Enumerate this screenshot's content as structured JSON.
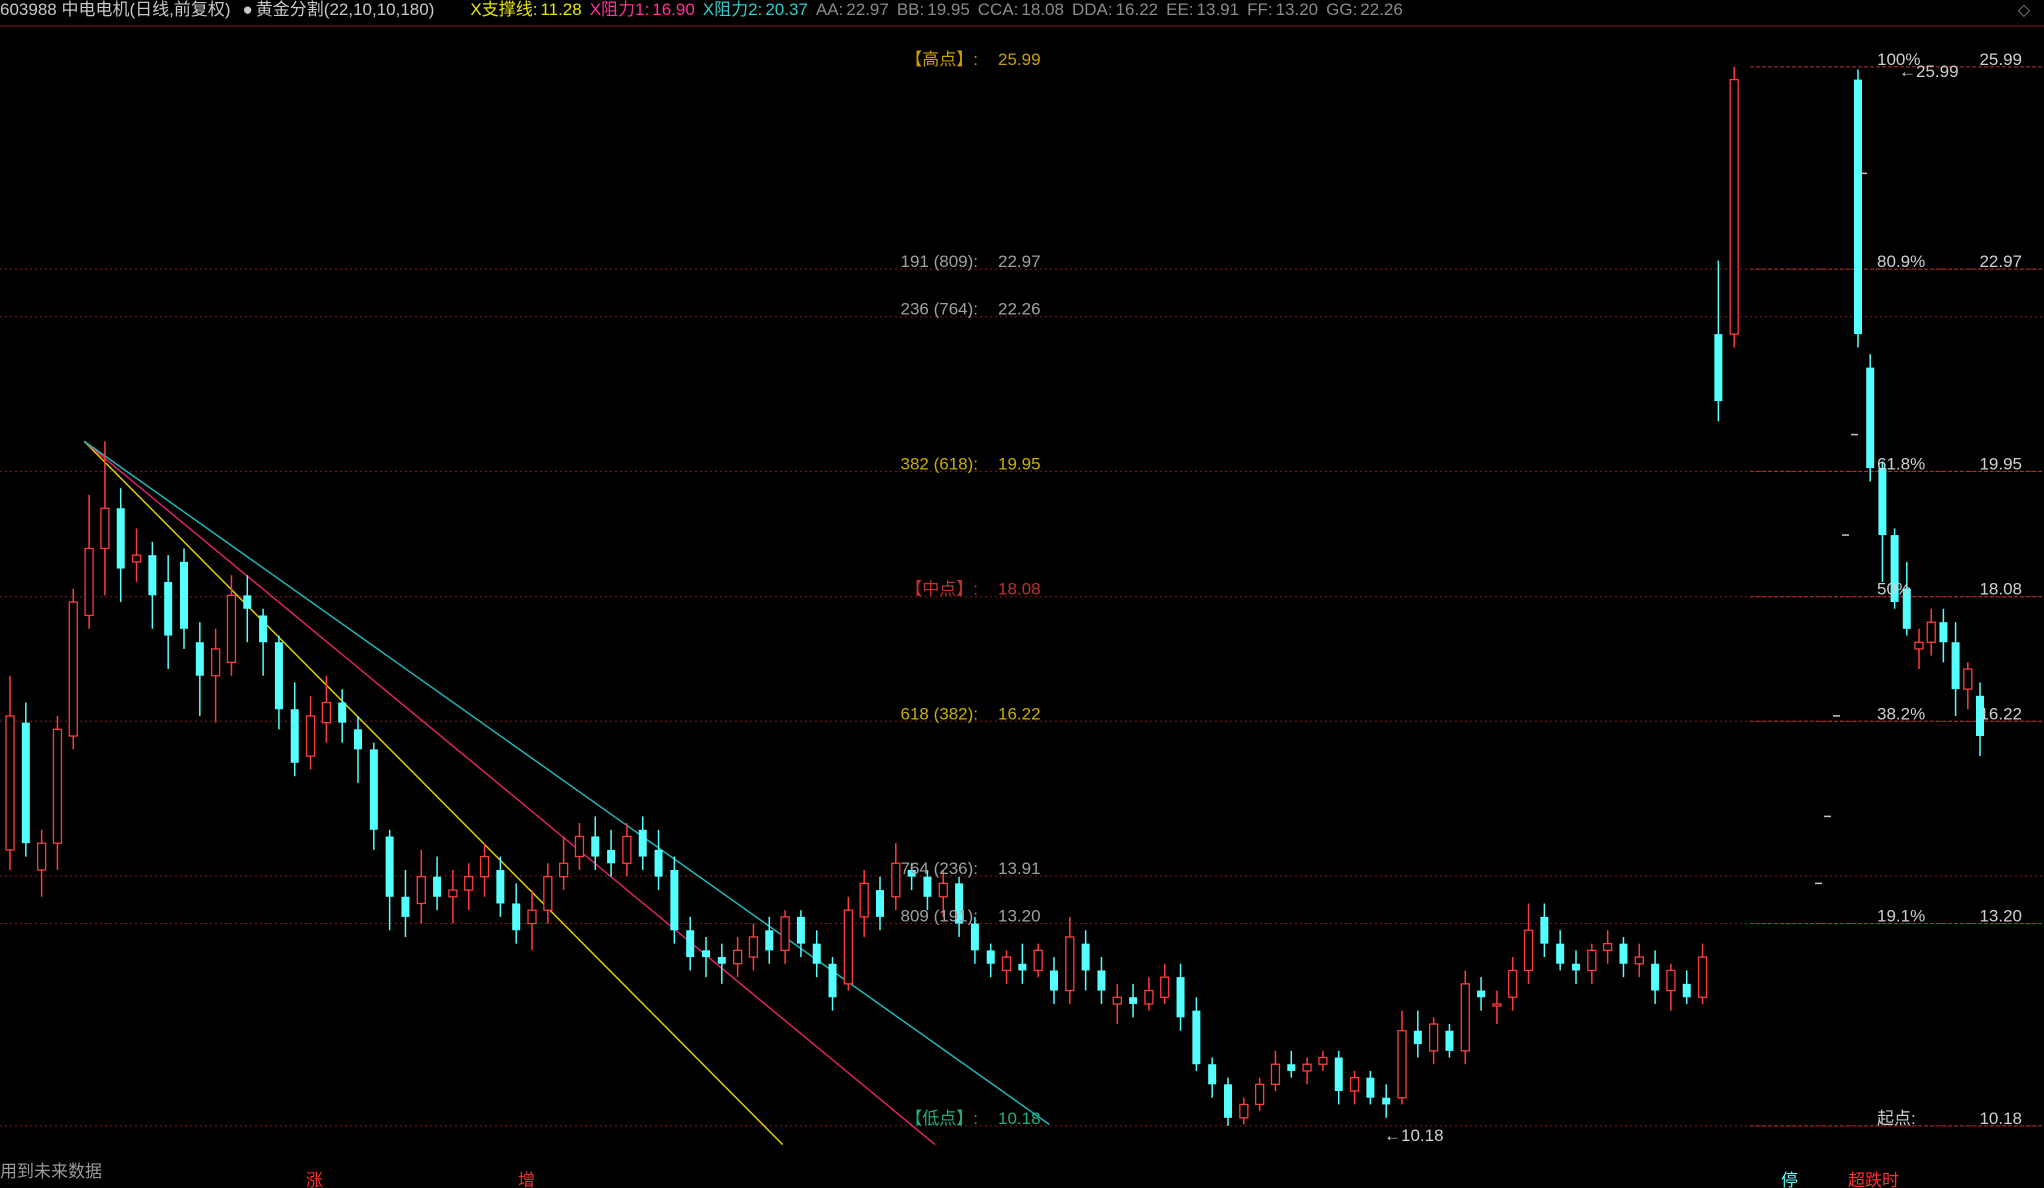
{
  "header": {
    "stock_title": "603988 中电电机(日线,前复权)",
    "indicator_icon": "check-circle-icon",
    "indicator_name": "黄金分割(22,10,10,180)",
    "readouts": [
      {
        "label": "X支撑线:",
        "value": "11.28",
        "color": "#e8e800"
      },
      {
        "label": "X阻力1:",
        "value": "16.90",
        "color": "#ff3399"
      },
      {
        "label": "X阻力2:",
        "value": "20.37",
        "color": "#33cccc"
      },
      {
        "label": "AA:",
        "value": "22.97",
        "color": "#8a8a8a"
      },
      {
        "label": "BB:",
        "value": "19.95",
        "color": "#8a8a8a"
      },
      {
        "label": "CCA:",
        "value": "18.08",
        "color": "#8a8a8a"
      },
      {
        "label": "DDA:",
        "value": "16.22",
        "color": "#8a8a8a"
      },
      {
        "label": "EE:",
        "value": "13.91",
        "color": "#8a8a8a"
      },
      {
        "label": "FF:",
        "value": "13.20",
        "color": "#8a8a8a"
      },
      {
        "label": "GG:",
        "value": "22.26",
        "color": "#8a8a8a"
      }
    ],
    "corner_icon": "diamond-icon"
  },
  "footer": {
    "note": "用到未来数据"
  },
  "chart_data": {
    "type": "candlestick",
    "ylim": [
      9.7,
      26.6
    ],
    "colors": {
      "up": "#ff3c3c",
      "down": "#54ffff",
      "grid": "#8a1c1c"
    },
    "left_levels": [
      {
        "label": "【高点】:",
        "value": "25.99",
        "y": 25.99,
        "label_color": "#c8a000",
        "value_color": "#c8a000",
        "line": false
      },
      {
        "label": "191 (809):",
        "value": "22.97",
        "y": 22.97,
        "label_color": "#a0a0a0",
        "value_color": "#a0a0a0",
        "line": true
      },
      {
        "label": "236 (764):",
        "value": "22.26",
        "y": 22.26,
        "label_color": "#a0a0a0",
        "value_color": "#a0a0a0",
        "line": true
      },
      {
        "label": "382 (618):",
        "value": "19.95",
        "y": 19.95,
        "label_color": "#c8b000",
        "value_color": "#c8b000",
        "line": true
      },
      {
        "label": "【中点】:",
        "value": "18.08",
        "y": 18.08,
        "label_color": "#c03030",
        "value_color": "#c03030",
        "line": true
      },
      {
        "label": "618 (382):",
        "value": "16.22",
        "y": 16.22,
        "label_color": "#c8b000",
        "value_color": "#c8b000",
        "line": true
      },
      {
        "label": "764 (236):",
        "value": "13.91",
        "y": 13.91,
        "label_color": "#a0a0a0",
        "value_color": "#a0a0a0",
        "line": true
      },
      {
        "label": "809 (191):",
        "value": "13.20",
        "y": 13.2,
        "label_color": "#a0a0a0",
        "value_color": "#a0a0a0",
        "line": true
      },
      {
        "label": "【低点】:",
        "value": "10.18",
        "y": 10.18,
        "label_color": "#20b080",
        "value_color": "#20b080",
        "line": true
      }
    ],
    "right_levels": [
      {
        "label": "100%",
        "value": "25.99",
        "y": 25.99
      },
      {
        "label": "80.9%",
        "value": "22.97",
        "y": 22.97
      },
      {
        "label": "61.8%",
        "value": "19.95",
        "y": 19.95
      },
      {
        "label": "50%",
        "value": "18.08",
        "y": 18.08
      },
      {
        "label": "38.2%",
        "value": "16.22",
        "y": 16.22
      },
      {
        "label": "19.1%",
        "value": "13.20",
        "y": 13.2
      },
      {
        "label": "起点:",
        "value": "10.18",
        "y": 10.18
      }
    ],
    "annotations": [
      {
        "text": "25.99",
        "x": 81,
        "y": 25.99
      },
      {
        "text": "10.18",
        "x": 60,
        "y": 10.18
      }
    ],
    "trendlines": [
      {
        "name": "X支撑线",
        "color": "#e0d000",
        "from": [
          6,
          20.4
        ],
        "to": [
          61,
          9.9
        ]
      },
      {
        "name": "X阻力1",
        "color": "#e0206a",
        "from": [
          6,
          20.4
        ],
        "to": [
          73,
          9.9
        ]
      },
      {
        "name": "X阻力2",
        "color": "#20b8b8",
        "from": [
          6,
          20.4
        ],
        "to": [
          82,
          10.2
        ]
      }
    ],
    "candles": [
      {
        "o": 14.3,
        "h": 16.9,
        "l": 14.0,
        "c": 16.3
      },
      {
        "o": 16.2,
        "h": 16.5,
        "l": 14.2,
        "c": 14.4
      },
      {
        "o": 14.0,
        "h": 14.6,
        "l": 13.6,
        "c": 14.4
      },
      {
        "o": 14.4,
        "h": 16.3,
        "l": 14.0,
        "c": 16.1
      },
      {
        "o": 16.0,
        "h": 18.2,
        "l": 15.8,
        "c": 18.0
      },
      {
        "o": 17.8,
        "h": 19.6,
        "l": 17.6,
        "c": 18.8
      },
      {
        "o": 18.8,
        "h": 20.4,
        "l": 18.1,
        "c": 19.4
      },
      {
        "o": 19.4,
        "h": 19.7,
        "l": 18.0,
        "c": 18.5
      },
      {
        "o": 18.6,
        "h": 19.1,
        "l": 18.3,
        "c": 18.7
      },
      {
        "o": 18.7,
        "h": 18.9,
        "l": 17.6,
        "c": 18.1
      },
      {
        "o": 18.3,
        "h": 18.7,
        "l": 17.0,
        "c": 17.5
      },
      {
        "o": 18.6,
        "h": 18.8,
        "l": 17.3,
        "c": 17.6
      },
      {
        "o": 17.4,
        "h": 17.7,
        "l": 16.3,
        "c": 16.9
      },
      {
        "o": 16.9,
        "h": 17.6,
        "l": 16.2,
        "c": 17.3
      },
      {
        "o": 17.1,
        "h": 18.4,
        "l": 16.9,
        "c": 18.1
      },
      {
        "o": 18.1,
        "h": 18.4,
        "l": 17.4,
        "c": 17.9
      },
      {
        "o": 17.8,
        "h": 17.9,
        "l": 16.9,
        "c": 17.4
      },
      {
        "o": 17.4,
        "h": 17.5,
        "l": 16.1,
        "c": 16.4
      },
      {
        "o": 16.4,
        "h": 16.8,
        "l": 15.4,
        "c": 15.6
      },
      {
        "o": 15.7,
        "h": 16.6,
        "l": 15.5,
        "c": 16.3
      },
      {
        "o": 16.2,
        "h": 16.9,
        "l": 15.9,
        "c": 16.5
      },
      {
        "o": 16.5,
        "h": 16.7,
        "l": 15.9,
        "c": 16.2
      },
      {
        "o": 16.1,
        "h": 16.3,
        "l": 15.3,
        "c": 15.8
      },
      {
        "o": 15.8,
        "h": 15.9,
        "l": 14.3,
        "c": 14.6
      },
      {
        "o": 14.5,
        "h": 14.6,
        "l": 13.1,
        "c": 13.6
      },
      {
        "o": 13.6,
        "h": 14.0,
        "l": 13.0,
        "c": 13.3
      },
      {
        "o": 13.5,
        "h": 14.3,
        "l": 13.2,
        "c": 13.9
      },
      {
        "o": 13.9,
        "h": 14.2,
        "l": 13.4,
        "c": 13.6
      },
      {
        "o": 13.6,
        "h": 14.0,
        "l": 13.2,
        "c": 13.7
      },
      {
        "o": 13.7,
        "h": 14.1,
        "l": 13.4,
        "c": 13.9
      },
      {
        "o": 13.9,
        "h": 14.4,
        "l": 13.6,
        "c": 14.2
      },
      {
        "o": 14.0,
        "h": 14.2,
        "l": 13.3,
        "c": 13.5
      },
      {
        "o": 13.5,
        "h": 13.8,
        "l": 12.9,
        "c": 13.1
      },
      {
        "o": 13.2,
        "h": 13.7,
        "l": 12.8,
        "c": 13.4
      },
      {
        "o": 13.4,
        "h": 14.1,
        "l": 13.2,
        "c": 13.9
      },
      {
        "o": 13.9,
        "h": 14.5,
        "l": 13.7,
        "c": 14.1
      },
      {
        "o": 14.2,
        "h": 14.7,
        "l": 14.0,
        "c": 14.5
      },
      {
        "o": 14.5,
        "h": 14.8,
        "l": 14.0,
        "c": 14.2
      },
      {
        "o": 14.3,
        "h": 14.6,
        "l": 13.9,
        "c": 14.1
      },
      {
        "o": 14.1,
        "h": 14.7,
        "l": 13.9,
        "c": 14.5
      },
      {
        "o": 14.6,
        "h": 14.8,
        "l": 14.0,
        "c": 14.2
      },
      {
        "o": 14.3,
        "h": 14.6,
        "l": 13.7,
        "c": 13.9
      },
      {
        "o": 14.0,
        "h": 14.2,
        "l": 12.9,
        "c": 13.1
      },
      {
        "o": 13.1,
        "h": 13.3,
        "l": 12.5,
        "c": 12.7
      },
      {
        "o": 12.8,
        "h": 13.0,
        "l": 12.4,
        "c": 12.7
      },
      {
        "o": 12.7,
        "h": 12.9,
        "l": 12.3,
        "c": 12.6
      },
      {
        "o": 12.6,
        "h": 13.0,
        "l": 12.4,
        "c": 12.8
      },
      {
        "o": 12.7,
        "h": 13.2,
        "l": 12.5,
        "c": 13.0
      },
      {
        "o": 13.1,
        "h": 13.3,
        "l": 12.6,
        "c": 12.8
      },
      {
        "o": 12.8,
        "h": 13.4,
        "l": 12.6,
        "c": 13.3
      },
      {
        "o": 13.3,
        "h": 13.4,
        "l": 12.7,
        "c": 12.9
      },
      {
        "o": 12.9,
        "h": 13.1,
        "l": 12.4,
        "c": 12.6
      },
      {
        "o": 12.6,
        "h": 12.7,
        "l": 11.9,
        "c": 12.1
      },
      {
        "o": 12.3,
        "h": 13.6,
        "l": 12.2,
        "c": 13.4
      },
      {
        "o": 13.3,
        "h": 14.0,
        "l": 13.0,
        "c": 13.8
      },
      {
        "o": 13.7,
        "h": 13.9,
        "l": 13.1,
        "c": 13.3
      },
      {
        "o": 13.6,
        "h": 14.4,
        "l": 13.4,
        "c": 14.1
      },
      {
        "o": 14.0,
        "h": 14.1,
        "l": 13.7,
        "c": 13.9
      },
      {
        "o": 13.9,
        "h": 14.0,
        "l": 13.4,
        "c": 13.6
      },
      {
        "o": 13.6,
        "h": 14.0,
        "l": 13.3,
        "c": 13.8
      },
      {
        "o": 13.8,
        "h": 13.9,
        "l": 13.0,
        "c": 13.2
      },
      {
        "o": 13.2,
        "h": 13.3,
        "l": 12.6,
        "c": 12.8
      },
      {
        "o": 12.8,
        "h": 12.9,
        "l": 12.4,
        "c": 12.6
      },
      {
        "o": 12.5,
        "h": 12.8,
        "l": 12.3,
        "c": 12.7
      },
      {
        "o": 12.6,
        "h": 12.9,
        "l": 12.3,
        "c": 12.5
      },
      {
        "o": 12.5,
        "h": 12.9,
        "l": 12.4,
        "c": 12.8
      },
      {
        "o": 12.5,
        "h": 12.7,
        "l": 12.0,
        "c": 12.2
      },
      {
        "o": 12.2,
        "h": 13.3,
        "l": 12.0,
        "c": 13.0
      },
      {
        "o": 12.9,
        "h": 13.1,
        "l": 12.2,
        "c": 12.5
      },
      {
        "o": 12.5,
        "h": 12.7,
        "l": 12.0,
        "c": 12.2
      },
      {
        "o": 12.0,
        "h": 12.3,
        "l": 11.7,
        "c": 12.1
      },
      {
        "o": 12.1,
        "h": 12.3,
        "l": 11.8,
        "c": 12.0
      },
      {
        "o": 12.0,
        "h": 12.4,
        "l": 11.9,
        "c": 12.2
      },
      {
        "o": 12.1,
        "h": 12.6,
        "l": 12.0,
        "c": 12.4
      },
      {
        "o": 12.4,
        "h": 12.6,
        "l": 11.6,
        "c": 11.8
      },
      {
        "o": 11.9,
        "h": 12.1,
        "l": 11.0,
        "c": 11.1
      },
      {
        "o": 11.1,
        "h": 11.2,
        "l": 10.6,
        "c": 10.8
      },
      {
        "o": 10.8,
        "h": 10.9,
        "l": 10.18,
        "c": 10.3
      },
      {
        "o": 10.3,
        "h": 10.6,
        "l": 10.2,
        "c": 10.5
      },
      {
        "o": 10.5,
        "h": 10.9,
        "l": 10.4,
        "c": 10.8
      },
      {
        "o": 10.8,
        "h": 11.3,
        "l": 10.7,
        "c": 11.1
      },
      {
        "o": 11.1,
        "h": 11.3,
        "l": 10.9,
        "c": 11.0
      },
      {
        "o": 11.0,
        "h": 11.2,
        "l": 10.8,
        "c": 11.1
      },
      {
        "o": 11.1,
        "h": 11.3,
        "l": 11.0,
        "c": 11.2
      },
      {
        "o": 11.2,
        "h": 11.3,
        "l": 10.5,
        "c": 10.7
      },
      {
        "o": 10.7,
        "h": 11.0,
        "l": 10.5,
        "c": 10.9
      },
      {
        "o": 10.9,
        "h": 11.0,
        "l": 10.5,
        "c": 10.6
      },
      {
        "o": 10.6,
        "h": 10.8,
        "l": 10.3,
        "c": 10.5
      },
      {
        "o": 10.6,
        "h": 11.9,
        "l": 10.5,
        "c": 11.6
      },
      {
        "o": 11.6,
        "h": 11.9,
        "l": 11.2,
        "c": 11.4
      },
      {
        "o": 11.3,
        "h": 11.8,
        "l": 11.1,
        "c": 11.7
      },
      {
        "o": 11.6,
        "h": 11.7,
        "l": 11.2,
        "c": 11.3
      },
      {
        "o": 11.3,
        "h": 12.5,
        "l": 11.1,
        "c": 12.3
      },
      {
        "o": 12.2,
        "h": 12.4,
        "l": 11.9,
        "c": 12.1
      },
      {
        "o": 12.0,
        "h": 12.2,
        "l": 11.7,
        "c": 12.0
      },
      {
        "o": 12.1,
        "h": 12.7,
        "l": 11.9,
        "c": 12.5
      },
      {
        "o": 12.5,
        "h": 13.5,
        "l": 12.3,
        "c": 13.1
      },
      {
        "o": 13.3,
        "h": 13.5,
        "l": 12.7,
        "c": 12.9
      },
      {
        "o": 12.9,
        "h": 13.1,
        "l": 12.5,
        "c": 12.6
      },
      {
        "o": 12.6,
        "h": 12.8,
        "l": 12.3,
        "c": 12.5
      },
      {
        "o": 12.5,
        "h": 12.9,
        "l": 12.3,
        "c": 12.8
      },
      {
        "o": 12.8,
        "h": 13.1,
        "l": 12.6,
        "c": 12.9
      },
      {
        "o": 12.9,
        "h": 13.0,
        "l": 12.4,
        "c": 12.6
      },
      {
        "o": 12.6,
        "h": 12.9,
        "l": 12.4,
        "c": 12.7
      },
      {
        "o": 12.6,
        "h": 12.8,
        "l": 12.0,
        "c": 12.2
      },
      {
        "o": 12.2,
        "h": 12.6,
        "l": 11.9,
        "c": 12.5
      },
      {
        "o": 12.3,
        "h": 12.5,
        "l": 12.0,
        "c": 12.1
      },
      {
        "o": 12.1,
        "h": 12.9,
        "l": 12.0,
        "c": 12.7
      },
      {
        "o": 22.0,
        "h": 23.1,
        "l": 20.7,
        "c": 21.0
      },
      {
        "o": 22.0,
        "h": 25.99,
        "l": 21.8,
        "c": 25.8
      },
      {
        "o": 25.8,
        "h": 25.95,
        "l": 21.8,
        "c": 22.0
      },
      {
        "o": 21.5,
        "h": 21.7,
        "l": 19.8,
        "c": 20.0
      },
      {
        "o": 20.0,
        "h": 20.1,
        "l": 18.3,
        "c": 19.0
      },
      {
        "o": 19.0,
        "h": 19.1,
        "l": 17.9,
        "c": 18.0
      },
      {
        "o": 18.2,
        "h": 18.6,
        "l": 17.5,
        "c": 17.6
      },
      {
        "o": 17.3,
        "h": 17.6,
        "l": 17.0,
        "c": 17.4
      },
      {
        "o": 17.4,
        "h": 17.9,
        "l": 17.2,
        "c": 17.7
      },
      {
        "o": 17.7,
        "h": 17.9,
        "l": 17.1,
        "c": 17.4
      },
      {
        "o": 17.4,
        "h": 17.7,
        "l": 16.3,
        "c": 16.7
      },
      {
        "o": 16.7,
        "h": 17.1,
        "l": 16.4,
        "c": 17.0
      },
      {
        "o": 16.6,
        "h": 16.8,
        "l": 15.7,
        "c": 16.0
      }
    ],
    "right_ticks": [
      {
        "y": 24.4
      },
      {
        "y": 20.5
      },
      {
        "y": 19.0
      },
      {
        "y": 16.3
      },
      {
        "y": 14.8
      },
      {
        "y": 13.8
      }
    ],
    "bottom_markers": [
      {
        "text": "涨",
        "color": "#ff3030"
      },
      {
        "text": "增",
        "color": "#ff3030"
      },
      {
        "text": "停",
        "color": "#54ffff"
      },
      {
        "text": "超跌时",
        "color": "#ff3030"
      }
    ]
  }
}
